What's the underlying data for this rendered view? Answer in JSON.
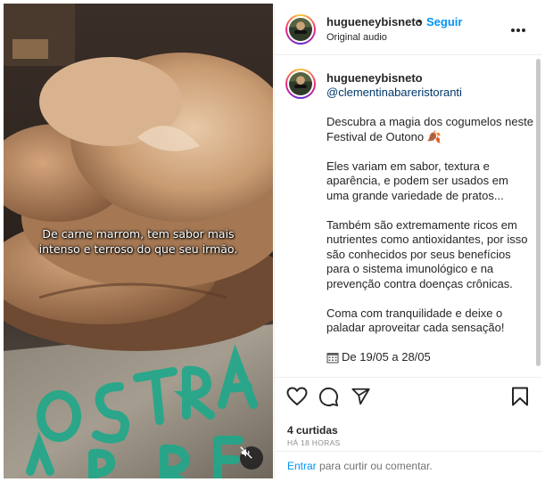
{
  "video": {
    "subtitle_line1": "De carne marrom, tem sabor mais",
    "subtitle_line2": "intenso e terroso do que seu irmão.",
    "sign_text": "OSTRA PARIS",
    "mute_icon": "speaker-muted-icon"
  },
  "header": {
    "username": "hugueneybisneto",
    "separator": "•",
    "follow_label": "Seguir",
    "audio_label": "Original audio",
    "more_icon": "more-horizontal-icon"
  },
  "caption": {
    "username": "hugueneybisneto",
    "mention": "@clementinabareristoranti",
    "paragraphs": [
      "Descubra a magia dos cogumelos neste Festival de Outono 🍂",
      "Eles variam em sabor, textura e aparência, e podem ser usados em uma grande variedade de pratos...",
      "Também são extremamente ricos em nutrientes como antioxidantes, por isso são conhecidos por seus benefícios para o sistema imunológico e na prevenção contra doenças crônicas.",
      "Coma com tranquilidade e deixe o paladar aproveitar cada sensação!"
    ],
    "date_range": "De 19/05 a 28/05",
    "date_icon": "calendar-icon"
  },
  "actions": {
    "like_icon": "heart-icon",
    "comment_icon": "comment-icon",
    "share_icon": "share-icon",
    "save_icon": "bookmark-icon",
    "likes_text": "4 curtidas",
    "time_text": "HÁ 18 HORAS"
  },
  "login": {
    "link_label": "Entrar",
    "rest_text": " para curtir ou comentar."
  },
  "colors": {
    "accent": "#0095f6",
    "mention": "#00376b",
    "sign_green": "#1fa88a"
  }
}
